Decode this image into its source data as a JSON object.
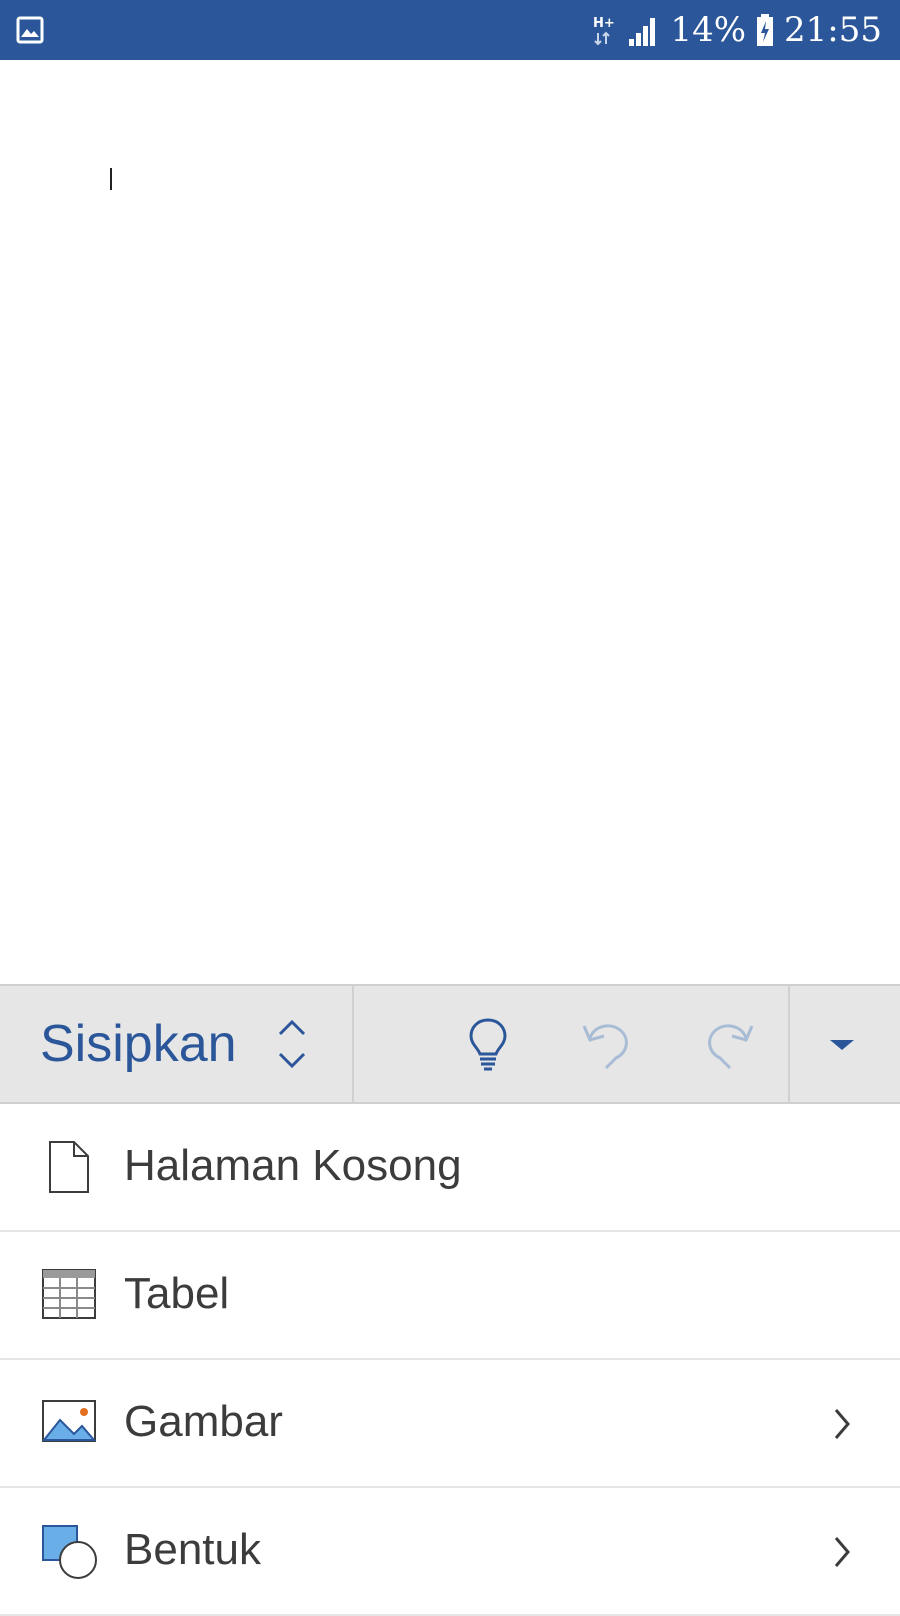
{
  "status_bar": {
    "network": "H+",
    "battery": "14%",
    "time": "21:55",
    "icons": [
      "gallery-icon",
      "network-hplus-icon",
      "signal-icon",
      "battery-charging-icon"
    ]
  },
  "ribbon": {
    "tab_label": "Sisipkan",
    "buttons": [
      "tab-switcher-icon",
      "lightbulb-icon",
      "undo-icon",
      "redo-icon",
      "dropdown-icon"
    ]
  },
  "menu": {
    "items": [
      {
        "label": "Halaman Kosong",
        "icon": "blank-page-icon",
        "has_submenu": false
      },
      {
        "label": "Tabel",
        "icon": "table-icon",
        "has_submenu": false
      },
      {
        "label": "Gambar",
        "icon": "picture-icon",
        "has_submenu": true
      },
      {
        "label": "Bentuk",
        "icon": "shapes-icon",
        "has_submenu": true
      }
    ]
  },
  "colors": {
    "accent": "#2b579a",
    "ribbon_bg": "#e6e6e6",
    "label_text": "#3c3c3c",
    "disabled_icon": "#a9bcd6"
  }
}
